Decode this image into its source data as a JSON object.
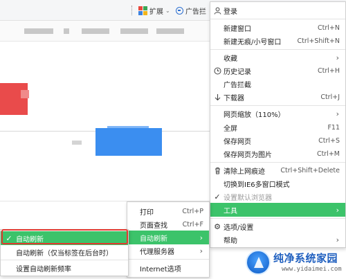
{
  "toolbar": {
    "extensions_label": "扩展",
    "adblock_label": "广告拦"
  },
  "main_menu": {
    "items": [
      {
        "label": "登录",
        "icon": "user-icon"
      },
      {
        "label": "新建窗口",
        "shortcut": "Ctrl+N"
      },
      {
        "label": "新建无痕/小号窗口",
        "shortcut": "Ctrl+Shift+N"
      },
      {
        "label": "收藏",
        "submenu": true
      },
      {
        "label": "历史记录",
        "shortcut": "Ctrl+H",
        "icon": "clock-icon"
      },
      {
        "label": "广告拦截"
      },
      {
        "label": "下载器",
        "shortcut": "Ctrl+J",
        "icon": "download-icon"
      },
      {
        "label": "网页缩放（110%）",
        "submenu": true
      },
      {
        "label": "全屏",
        "shortcut": "F11"
      },
      {
        "label": "保存网页",
        "shortcut": "Ctrl+S"
      },
      {
        "label": "保存网页为图片",
        "shortcut": "Ctrl+M"
      },
      {
        "label": "清除上网痕迹",
        "shortcut": "Ctrl+Shift+Delete",
        "icon": "trash-icon"
      },
      {
        "label": "切换到IE6多窗口模式"
      },
      {
        "label": "设置默认浏览器",
        "disabled": true,
        "icon": "check-icon"
      },
      {
        "label": "工具",
        "submenu": true,
        "highlighted": true
      },
      {
        "label": "选项/设置",
        "icon": "gear-icon"
      },
      {
        "label": "帮助",
        "submenu": true
      }
    ]
  },
  "tools_menu": {
    "items": [
      {
        "label": "打印",
        "shortcut": "Ctrl+P"
      },
      {
        "label": "页面查找",
        "shortcut": "Ctrl+F"
      },
      {
        "label": "自动刷新",
        "submenu": true,
        "highlighted": true
      },
      {
        "label": "代理服务器",
        "submenu": true
      },
      {
        "label": "Internet选项"
      }
    ]
  },
  "refresh_menu": {
    "items": [
      {
        "label": "自动刷新",
        "checked": true,
        "highlighted": true
      },
      {
        "label": "自动刷新（仅当标签在后台时）"
      },
      {
        "label": "设置自动刷新频率"
      }
    ]
  },
  "watermark": {
    "title": "纯净系统家园",
    "url": "www.yidaimei.com"
  },
  "colors": {
    "highlight": "#3cc36a",
    "annotation_box": "#e2372e"
  }
}
